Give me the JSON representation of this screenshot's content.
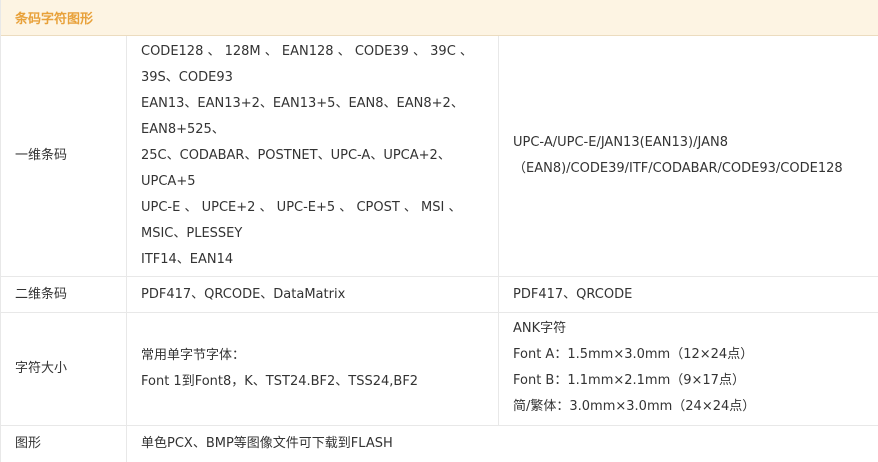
{
  "section": {
    "title": "条码字符图形"
  },
  "rows": {
    "barcode_1d": {
      "label": "一维条码",
      "left_lines": [
        "CODE128 、 128M 、 EAN128 、 CODE39 、 39C 、",
        "39S、CODE93",
        "EAN13、EAN13+2、EAN13+5、EAN8、EAN8+2、",
        "EAN8+525、",
        "25C、CODABAR、POSTNET、UPC-A、UPCA+2、",
        "UPCA+5",
        "UPC-E 、 UPCE+2 、 UPC-E+5 、 CPOST 、 MSI 、",
        "MSIC、PLESSEY",
        "ITF14、EAN14"
      ],
      "right_lines": [
        "UPC-A/UPC-E/JAN13(EAN13)/JAN8",
        "（EAN8)/CODE39/ITF/CODABAR/CODE93/CODE128"
      ]
    },
    "barcode_2d": {
      "label": "二维条码",
      "left": "PDF417、QRCODE、DataMatrix",
      "right": "PDF417、QRCODE"
    },
    "font_size": {
      "label": "字符大小",
      "left_lines": [
        "常用单字节字体：",
        "Font 1到Font8，K、TST24.BF2、TSS24,BF2"
      ],
      "right_lines": [
        "ANK字符",
        "Font A：1.5mm×3.0mm（12×24点）",
        "Font B：1.1mm×2.1mm（9×17点）",
        "简/繁体：3.0mm×3.0mm（24×24点）"
      ]
    },
    "graphics": {
      "label": "图形",
      "value": "单色PCX、BMP等图像文件可下载到FLASH"
    }
  },
  "colors": {
    "header_bg": "#fdf4e3",
    "header_text": "#e8a13a",
    "border": "#e8e8e8",
    "text": "#333333"
  }
}
